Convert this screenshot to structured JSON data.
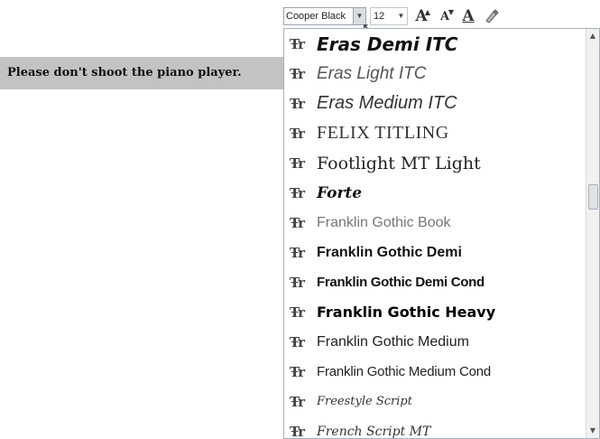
{
  "document": {
    "selected_text": "Please don't shoot the piano player."
  },
  "toolbar": {
    "font_name": "Cooper Black",
    "font_size": "12",
    "grow_font_label": "A",
    "shrink_font_label": "A",
    "font_color_label": "A"
  },
  "font_list": {
    "icon_label": "Ŧr",
    "items": [
      {
        "label": "Eras Demi ITC"
      },
      {
        "label": "Eras Light ITC"
      },
      {
        "label": "Eras Medium ITC"
      },
      {
        "label": "FELIX TITLING"
      },
      {
        "label": "Footlight MT Light"
      },
      {
        "label": "Forte"
      },
      {
        "label": "Franklin Gothic Book"
      },
      {
        "label": "Franklin Gothic Demi"
      },
      {
        "label": "Franklin Gothic Demi Cond"
      },
      {
        "label": "Franklin Gothic Heavy"
      },
      {
        "label": "Franklin Gothic Medium"
      },
      {
        "label": "Franklin Gothic Medium Cond"
      },
      {
        "label": "Freestyle Script"
      },
      {
        "label": "French Script MT"
      }
    ]
  }
}
